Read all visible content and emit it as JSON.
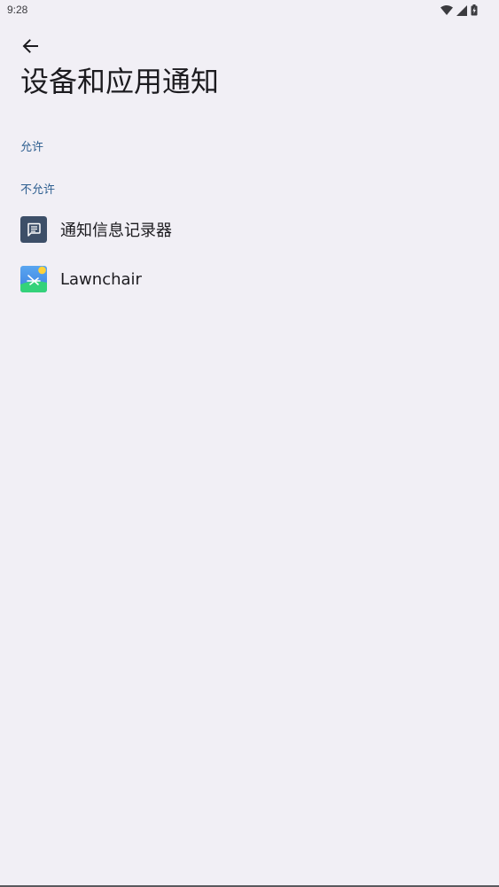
{
  "status_bar": {
    "time": "9:28"
  },
  "header": {
    "title": "设备和应用通知"
  },
  "sections": {
    "allowed": {
      "label": "允许"
    },
    "not_allowed": {
      "label": "不允许",
      "apps": [
        {
          "name": "通知信息记录器",
          "icon": "message-icon"
        },
        {
          "name": "Lawnchair",
          "icon": "lawnchair-icon"
        }
      ]
    }
  },
  "colors": {
    "background": "#f1eff5",
    "section_header": "#2e5f90",
    "notification_logger_icon_bg": "#3d4f68"
  }
}
